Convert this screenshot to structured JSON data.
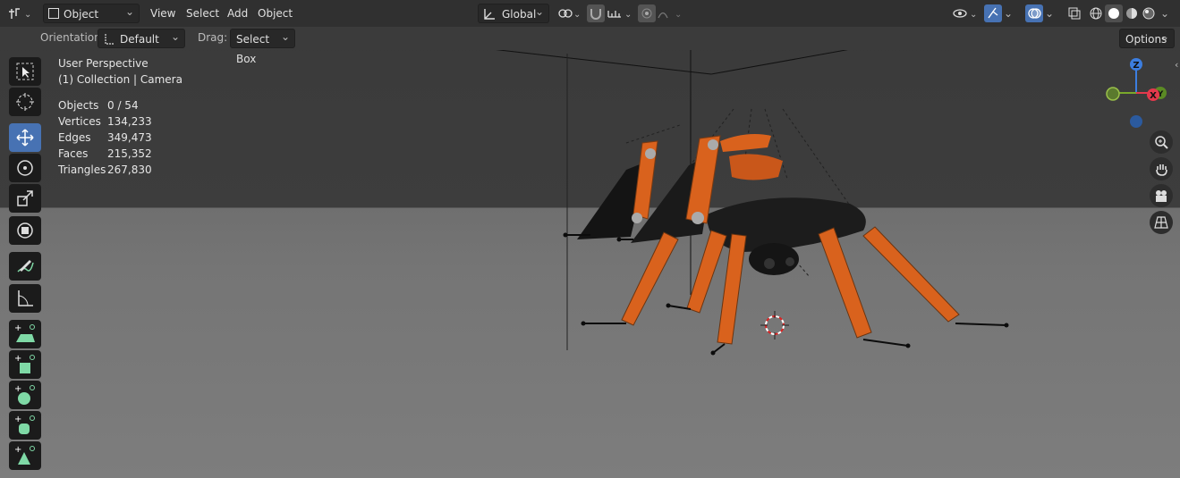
{
  "header": {
    "mode": "Object Mode",
    "menus": [
      "View",
      "Select",
      "Add",
      "Object"
    ],
    "transform_orientation": "Global"
  },
  "subbar": {
    "orientation_label": "Orientation:",
    "orientation_value": "Default",
    "drag_label": "Drag:",
    "drag_value": "Select Box",
    "options_label": "Options"
  },
  "overlay": {
    "view_name": "User Perspective",
    "collection": "(1) Collection | Camera",
    "stats": [
      {
        "key": "Objects",
        "value": "0 / 54"
      },
      {
        "key": "Vertices",
        "value": "134,233"
      },
      {
        "key": "Edges",
        "value": "349,473"
      },
      {
        "key": "Faces",
        "value": "215,352"
      },
      {
        "key": "Triangles",
        "value": "267,830"
      }
    ]
  },
  "gizmo": {
    "z": "Z",
    "x": "X",
    "y": "Y"
  },
  "colors": {
    "accent": "#4772b3",
    "model_orange": "#d9621d",
    "axis_x": "#e3394c",
    "axis_y": "#7aa82b",
    "axis_z": "#3c7ee0",
    "add_tool_green": "#7fd9a6"
  },
  "icons": {
    "tools": [
      "select-box-icon",
      "cursor-icon",
      "move-icon",
      "rotate-icon",
      "scale-icon",
      "transform-icon",
      "annotate-icon",
      "measure-icon",
      "add-plane-icon",
      "add-cube-icon",
      "add-sphere-icon",
      "add-cylinder-icon",
      "add-cone-icon"
    ],
    "nav": [
      "zoom-icon",
      "pan-hand-icon",
      "camera-view-icon",
      "grid-view-icon"
    ]
  }
}
